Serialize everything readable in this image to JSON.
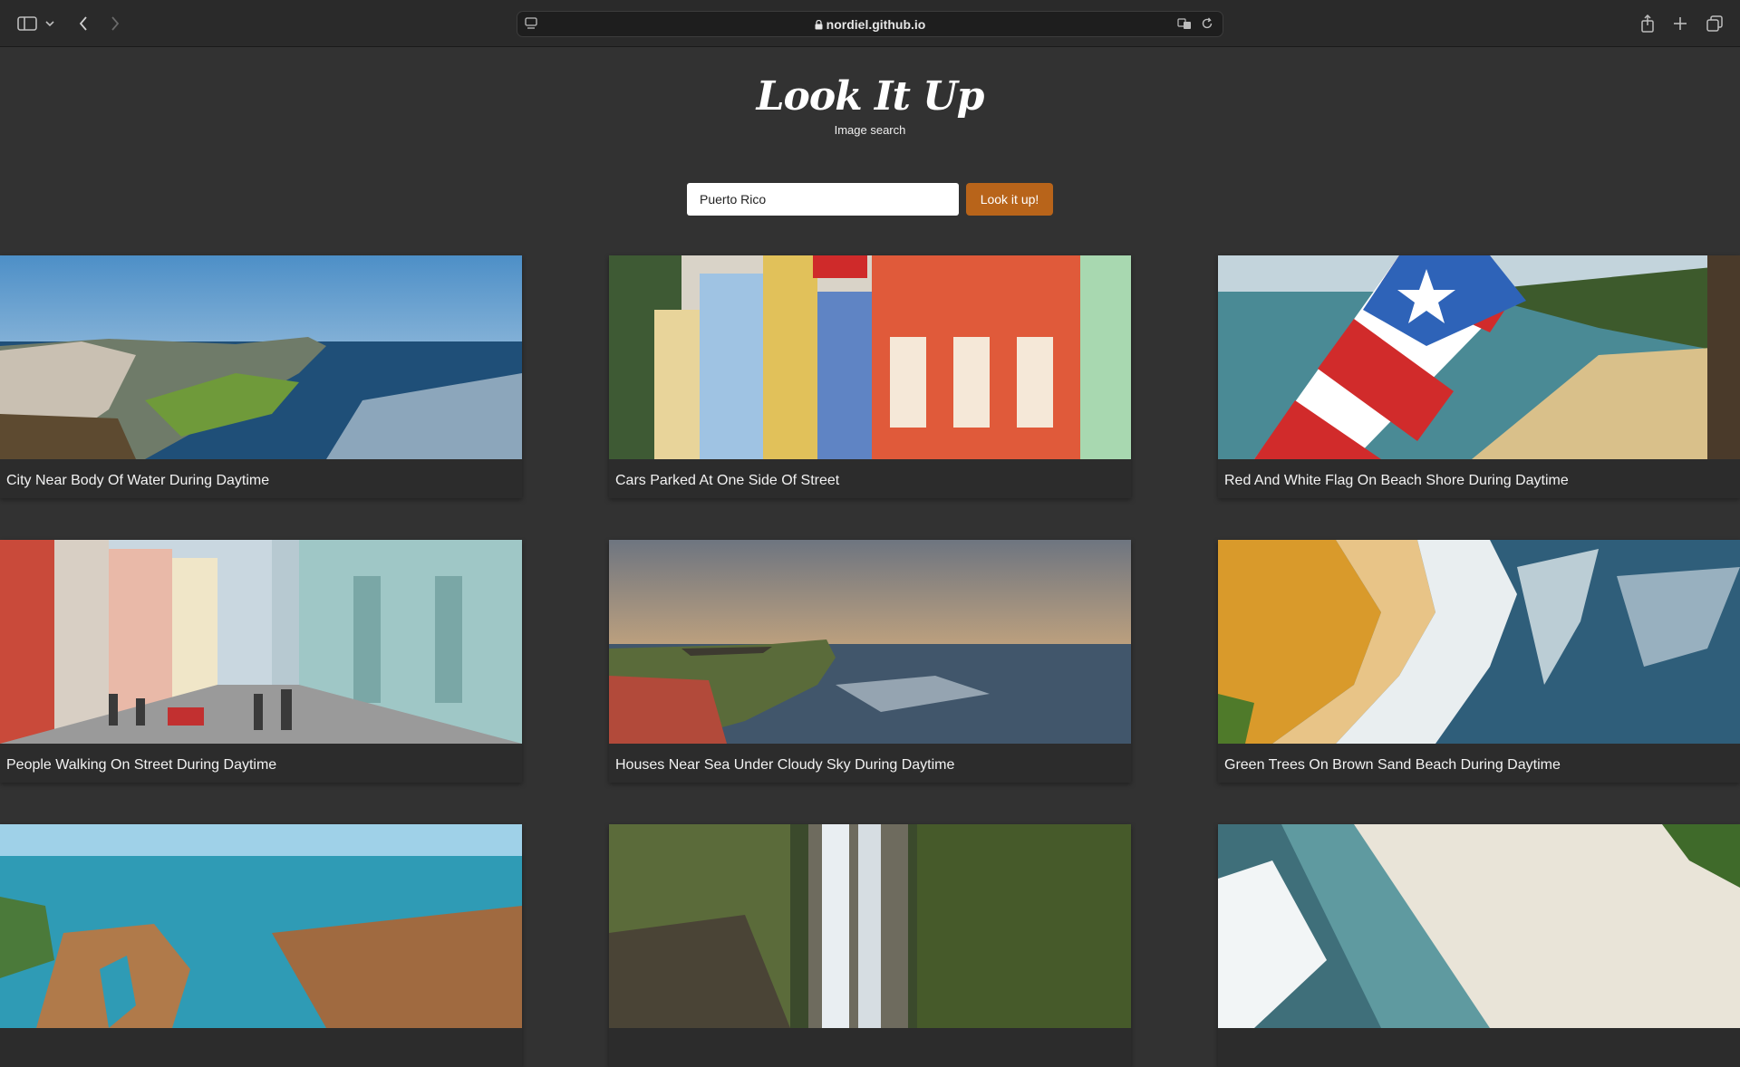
{
  "browser": {
    "url": "nordiel.github.io"
  },
  "header": {
    "title": "Look It Up",
    "subtitle": "Image search"
  },
  "search": {
    "value": "Puerto Rico",
    "button_label": "Look it up!"
  },
  "results": [
    {
      "caption": "City Near Body Of Water During Daytime"
    },
    {
      "caption": "Cars Parked At One Side Of Street"
    },
    {
      "caption": "Red And White Flag On Beach Shore During Daytime"
    },
    {
      "caption": "People Walking On Street During Daytime"
    },
    {
      "caption": "Houses Near Sea Under Cloudy Sky During Daytime"
    },
    {
      "caption": "Green Trees On Brown Sand Beach During Daytime"
    },
    {
      "caption": ""
    },
    {
      "caption": ""
    },
    {
      "caption": ""
    }
  ]
}
